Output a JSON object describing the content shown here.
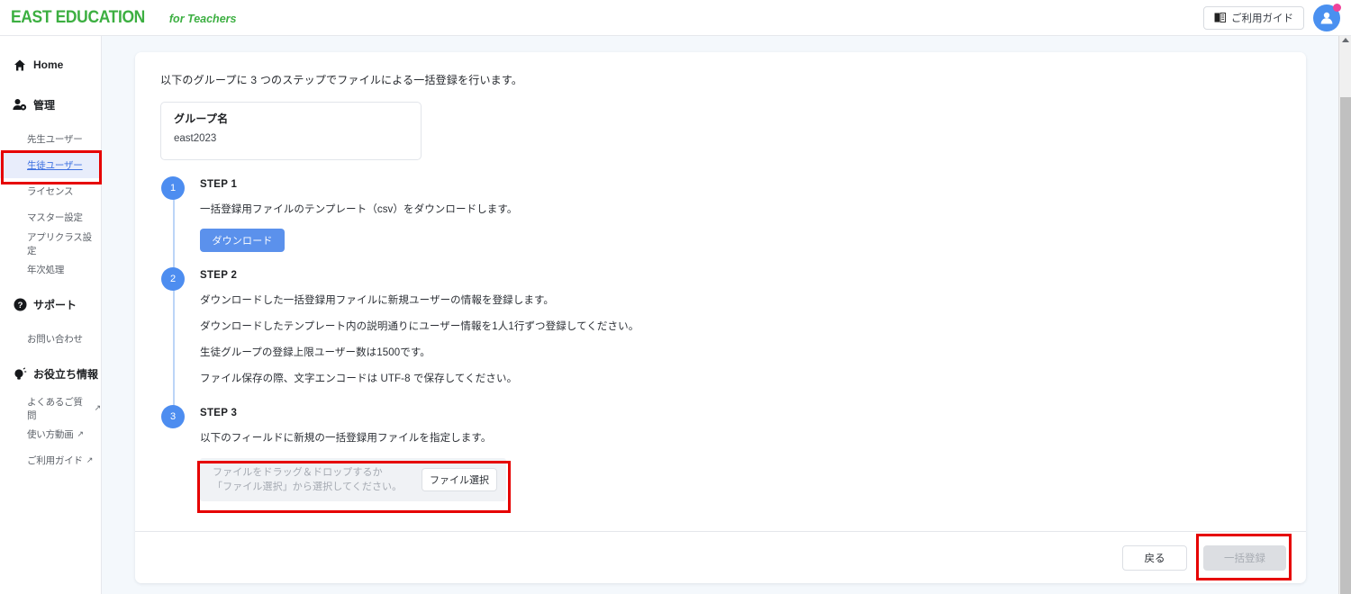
{
  "header": {
    "logo_main": "EAST EDUCATION",
    "logo_sub": "for Teachers",
    "guide_button": "ご利用ガイド",
    "guide_icon": "book-icon",
    "avatar_icon": "user-avatar-icon",
    "notification_badge_color": "#f0439a"
  },
  "sidebar": {
    "items": [
      {
        "label": "Home",
        "icon": "home-icon",
        "type": "top",
        "active": false
      },
      {
        "label": "管理",
        "icon": "manage-user-gear-icon",
        "type": "top",
        "active": false
      },
      {
        "label": "先生ユーザー",
        "type": "sub",
        "active": false
      },
      {
        "label": "生徒ユーザー",
        "type": "sub",
        "active": true
      },
      {
        "label": "ライセンス",
        "type": "sub",
        "active": false
      },
      {
        "label": "マスター設定",
        "type": "sub",
        "active": false
      },
      {
        "label": "アプリクラス設定",
        "type": "sub",
        "active": false
      },
      {
        "label": "年次処理",
        "type": "sub",
        "active": false
      },
      {
        "label": "サポート",
        "icon": "question-circle-icon",
        "type": "top",
        "active": false
      },
      {
        "label": "お問い合わせ",
        "type": "sub",
        "active": false
      },
      {
        "label": "お役立ち情報",
        "icon": "lightbulb-icon",
        "type": "top",
        "active": false
      },
      {
        "label": "よくあるご質問",
        "type": "sub",
        "active": false,
        "external": "↗"
      },
      {
        "label": "使い方動画",
        "type": "sub",
        "active": false,
        "external": "↗"
      },
      {
        "label": "ご利用ガイド",
        "type": "sub",
        "active": false,
        "external": "↗"
      }
    ],
    "active_bg": "#e8edfb",
    "active_color": "#3b6fe0"
  },
  "main": {
    "intro": "以下のグループに 3 つのステップでファイルによる一括登録を行います。",
    "group": {
      "label": "グループ名",
      "value": "east2023"
    },
    "steps": [
      {
        "number": "1",
        "title": "STEP 1",
        "lines": [
          "一括登録用ファイルのテンプレート（csv）をダウンロードします。"
        ],
        "button": "ダウンロード"
      },
      {
        "number": "2",
        "title": "STEP 2",
        "lines": [
          "ダウンロードした一括登録用ファイルに新規ユーザーの情報を登録します。",
          "ダウンロードしたテンプレート内の説明通りにユーザー情報を1人1行ずつ登録してください。",
          "生徒グループの登録上限ユーザー数は1500です。",
          "ファイル保存の際、文字エンコードは UTF-8 で保存してください。"
        ]
      },
      {
        "number": "3",
        "title": "STEP 3",
        "lines": [
          "以下のフィールドに新規の一括登録用ファイルを指定します。"
        ],
        "dropzone": {
          "line1": "ファイルをドラッグ＆ドロップするか",
          "line2": "「ファイル選択」から選択してください。",
          "button": "ファイル選択"
        }
      }
    ],
    "footer": {
      "back_button": "戻る",
      "submit_button": "一括登録",
      "submit_disabled": true
    }
  },
  "colors": {
    "brand_green": "#3caf41",
    "accent_blue": "#4d8df0",
    "step_button_blue": "#5b91ec",
    "annotation_red": "#e60000",
    "page_bg": "#f4f8fc"
  },
  "annotations": {
    "boxes": [
      {
        "name": "sidebar-student-user-highlight"
      },
      {
        "name": "dropzone-highlight"
      },
      {
        "name": "submit-button-highlight"
      }
    ]
  }
}
